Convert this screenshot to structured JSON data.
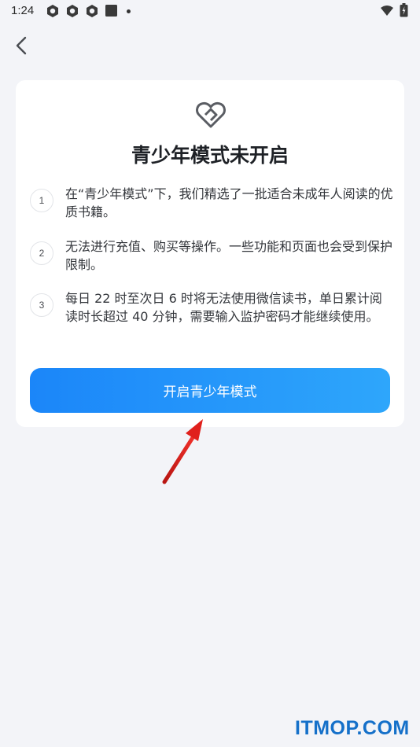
{
  "status_bar": {
    "time": "1:24",
    "icons": [
      "app-notification-icon",
      "app-notification-icon",
      "app-notification-icon",
      "app-square-icon",
      "more-dot-icon",
      "wifi-icon",
      "battery-icon"
    ]
  },
  "nav": {
    "back_icon": "chevron-left-icon"
  },
  "card": {
    "icon": "heart-shield-icon",
    "title": "青少年模式未开启",
    "rules": [
      {
        "number": "1",
        "text": "在“青少年模式”下，我们精选了一批适合未成年人阅读的优质书籍。"
      },
      {
        "number": "2",
        "text": "无法进行充值、购买等操作。一些功能和页面也会受到保护限制。"
      },
      {
        "number": "3",
        "text": "每日 22 时至次日 6 时将无法使用微信读书，单日累计阅读时长超过 40 分钟，需要输入监护密码才能继续使用。"
      }
    ],
    "button_label": "开启青少年模式"
  },
  "watermark": "ITMOP.COM",
  "colors": {
    "background": "#f3f4f8",
    "card": "#ffffff",
    "button_start": "#1b86f9",
    "button_end": "#2ea6fb",
    "arrow": "#e0201c",
    "watermark": "#1570c9"
  }
}
